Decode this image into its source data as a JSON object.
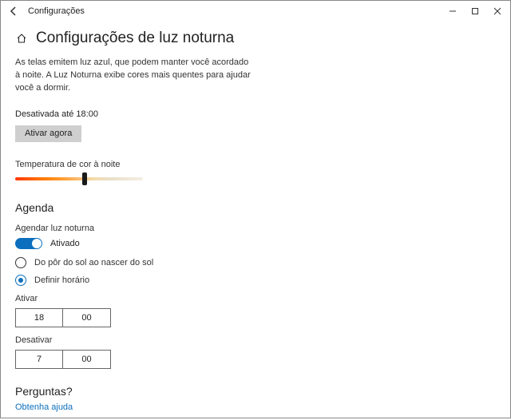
{
  "window": {
    "title": "Configurações"
  },
  "page": {
    "title": "Configurações de luz noturna",
    "description": "As telas emitem luz azul, que podem manter você acordado à noite. A Luz Noturna exibe cores mais quentes para ajudar você a dormir.",
    "status": "Desativada até 18:00",
    "activate_button": "Ativar agora"
  },
  "slider": {
    "label": "Temperatura de cor à noite"
  },
  "schedule": {
    "heading": "Agenda",
    "toggle_label": "Agendar luz noturna",
    "toggle_state": "Ativado",
    "option_sun": "Do pôr do sol ao nascer do sol",
    "option_hours": "Definir horário",
    "activate_label": "Ativar",
    "activate_hour": "18",
    "activate_minute": "00",
    "deactivate_label": "Desativar",
    "deactivate_hour": "7",
    "deactivate_minute": "00"
  },
  "help": {
    "heading": "Perguntas?",
    "link": "Obtenha ajuda"
  }
}
